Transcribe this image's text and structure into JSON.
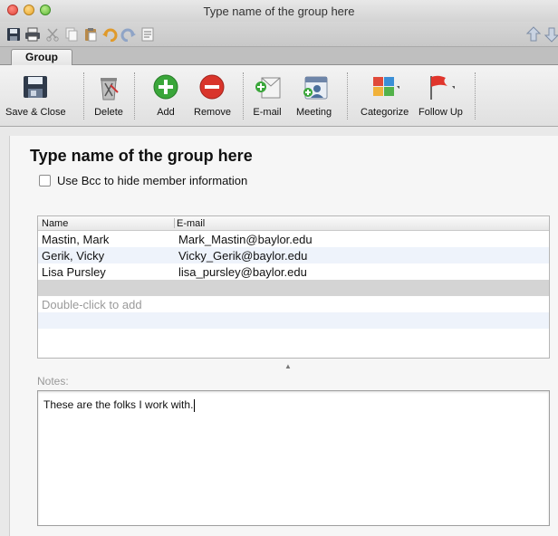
{
  "window": {
    "title": "Type name of the group here"
  },
  "quick_toolbar": {
    "icons": [
      "save-icon",
      "print-icon",
      "cut-icon",
      "copy-icon",
      "paste-icon",
      "undo-icon",
      "redo-icon",
      "format-icon",
      "up-arrow-icon",
      "down-arrow-icon"
    ]
  },
  "ribbon": {
    "active_tab": "Group",
    "buttons": {
      "save_close": "Save & Close",
      "delete": "Delete",
      "add": "Add",
      "remove": "Remove",
      "email": "E-mail",
      "meeting": "Meeting",
      "categorize": "Categorize",
      "follow_up": "Follow Up"
    }
  },
  "group": {
    "name": "Type name of the group here",
    "bcc_label": "Use Bcc to hide member information",
    "bcc_checked": false
  },
  "members": {
    "columns": {
      "name": "Name",
      "email": "E-mail"
    },
    "rows": [
      {
        "name": "Mastin, Mark",
        "email": "Mark_Mastin@baylor.edu"
      },
      {
        "name": "Gerik, Vicky",
        "email": "Vicky_Gerik@baylor.edu"
      },
      {
        "name": "Lisa Pursley",
        "email": "lisa_pursley@baylor.edu"
      }
    ],
    "add_hint": "Double-click to add"
  },
  "notes": {
    "label": "Notes:",
    "text": "These are the folks I work with."
  },
  "colors": {
    "add_green": "#3aa63a",
    "remove_red": "#d9352b",
    "alt_row": "#eef3fb"
  }
}
